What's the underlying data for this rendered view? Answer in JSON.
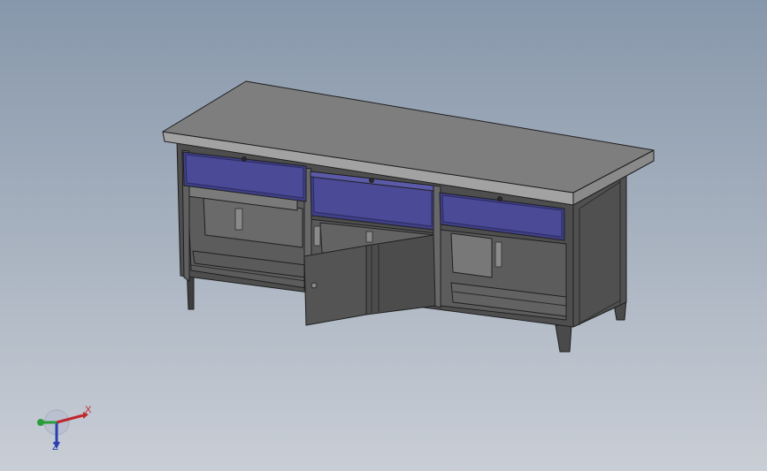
{
  "viewport": {
    "background_top": "#8797ab",
    "background_bottom": "#c9ced6"
  },
  "model": {
    "top_color": "#7e7e7e",
    "body_color": "#545454",
    "edge_color": "#1f1f1f",
    "drawer_color": "#3f3f86",
    "drawer_highlight": "#5a5aa8"
  },
  "triad": {
    "x_label": "X",
    "z_label": "Z",
    "x_color": "#c0272d",
    "y_color": "#2a9d3a",
    "z_color": "#2a3fb0"
  }
}
